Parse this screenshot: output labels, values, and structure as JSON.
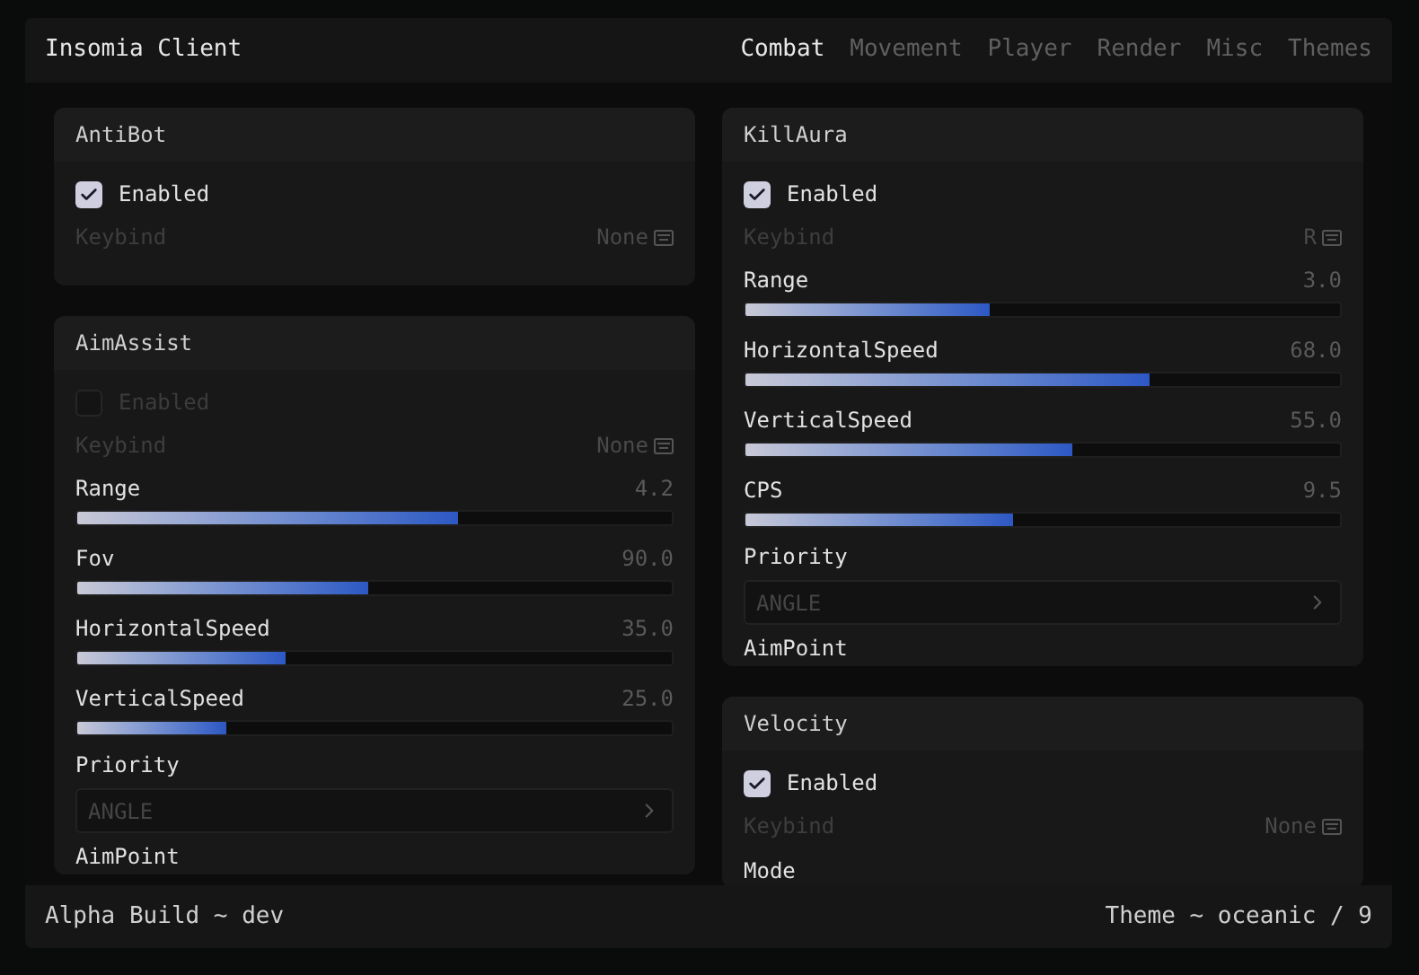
{
  "window": {
    "title": "Insomia Client"
  },
  "tabs": [
    {
      "label": "Combat",
      "selected": true
    },
    {
      "label": "Movement",
      "selected": false
    },
    {
      "label": "Player",
      "selected": false
    },
    {
      "label": "Render",
      "selected": false
    },
    {
      "label": "Misc",
      "selected": false
    },
    {
      "label": "Themes",
      "selected": false
    }
  ],
  "columns": [
    [
      {
        "name": "AntiBot",
        "settings": [
          {
            "kind": "checkbox",
            "label": "Enabled",
            "checked": true
          },
          {
            "kind": "keybind",
            "label": "Keybind",
            "value": "None"
          }
        ]
      },
      {
        "name": "AimAssist",
        "settings": [
          {
            "kind": "checkbox",
            "label": "Enabled",
            "checked": false
          },
          {
            "kind": "keybind",
            "label": "Keybind",
            "value": "None"
          },
          {
            "kind": "slider",
            "label": "Range",
            "reading": "4.2",
            "level": 0.64
          },
          {
            "kind": "slider",
            "label": "Fov",
            "reading": "90.0",
            "level": 0.49
          },
          {
            "kind": "slider",
            "label": "HorizontalSpeed",
            "reading": "35.0",
            "level": 0.35
          },
          {
            "kind": "slider",
            "label": "VerticalSpeed",
            "reading": "25.0",
            "level": 0.25
          },
          {
            "kind": "dropdown",
            "label": "Priority",
            "value": "ANGLE"
          },
          {
            "kind": "heading",
            "label": "AimPoint"
          }
        ]
      }
    ],
    [
      {
        "name": "KillAura",
        "settings": [
          {
            "kind": "checkbox",
            "label": "Enabled",
            "checked": true
          },
          {
            "kind": "keybind",
            "label": "Keybind",
            "value": "R"
          },
          {
            "kind": "slider",
            "label": "Range",
            "reading": "3.0",
            "level": 0.41
          },
          {
            "kind": "slider",
            "label": "HorizontalSpeed",
            "reading": "68.0",
            "level": 0.68
          },
          {
            "kind": "slider",
            "label": "VerticalSpeed",
            "reading": "55.0",
            "level": 0.55
          },
          {
            "kind": "slider",
            "label": "CPS",
            "reading": "9.5",
            "level": 0.45
          },
          {
            "kind": "dropdown",
            "label": "Priority",
            "value": "ANGLE"
          },
          {
            "kind": "heading",
            "label": "AimPoint"
          }
        ]
      },
      {
        "name": "Velocity",
        "settings": [
          {
            "kind": "checkbox",
            "label": "Enabled",
            "checked": true
          },
          {
            "kind": "keybind",
            "label": "Keybind",
            "value": "None"
          },
          {
            "kind": "heading",
            "label": "Mode"
          }
        ]
      }
    ]
  ],
  "status_bar": {
    "left": "Alpha Build ~ dev",
    "right": "Theme ~ oceanic / 9"
  }
}
